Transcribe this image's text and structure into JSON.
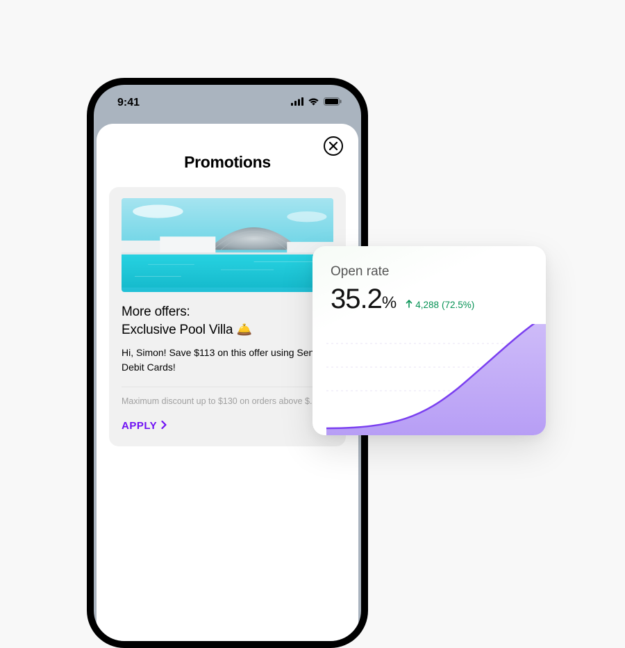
{
  "status": {
    "time": "9:41"
  },
  "app": {
    "title": "Promotions"
  },
  "promo": {
    "heading_line1": "More offers:",
    "heading_line2": "Exclusive Pool Villa",
    "bell_emoji": "🛎️",
    "body": "Hi, Simon! Save $113  on this offer using Send Debit Cards!",
    "note": "Maximum discount up to $130 on orders above $.",
    "apply_label": "APPLY"
  },
  "stat": {
    "label": "Open rate",
    "value": "35.2",
    "unit": "%",
    "delta_count": "4,288",
    "delta_pct": "(72.5%)"
  },
  "colors": {
    "accent": "#6f10f4",
    "positive": "#059254",
    "chart_fill": "#c9b9f7",
    "chart_stroke": "#7a3ff0"
  }
}
